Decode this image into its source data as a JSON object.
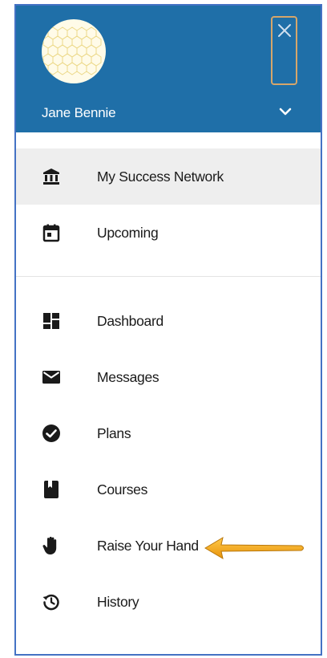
{
  "profile": {
    "name": "Jane Bennie",
    "close_icon": "close-icon",
    "expand_icon": "chevron-down-icon"
  },
  "nav": {
    "primary": [
      {
        "label": "My Success Network",
        "icon": "institution-icon",
        "active": true
      },
      {
        "label": "Upcoming",
        "icon": "calendar-icon",
        "active": false
      }
    ],
    "secondary": [
      {
        "label": "Dashboard",
        "icon": "dashboard-icon"
      },
      {
        "label": "Messages",
        "icon": "envelope-icon"
      },
      {
        "label": "Plans",
        "icon": "check-circle-icon"
      },
      {
        "label": "Courses",
        "icon": "book-icon"
      },
      {
        "label": "Raise Your Hand",
        "icon": "hand-icon"
      },
      {
        "label": "History",
        "icon": "history-icon"
      }
    ]
  },
  "annotation": {
    "arrow_icon": "arrow-left-icon",
    "color": "#f2a516"
  },
  "colors": {
    "header": "#1f6fa8",
    "active_row": "#eeeeee",
    "frame_border": "#4472c4",
    "close_border": "#d6a66a"
  }
}
